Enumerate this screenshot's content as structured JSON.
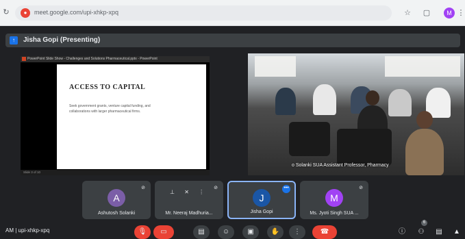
{
  "browser": {
    "url": "meet.google.com/upi-xhkp-xpq",
    "site_icon": "google-meet-icon",
    "profile_letter": "M"
  },
  "presenting_bar": {
    "label": "Jisha Gopi (Presenting)"
  },
  "shared_screen": {
    "app_title": "PowerPoint Slide Show - Challenges and Solutions Pharmaceutical.pptx - PowerPoint",
    "slide_title": "ACCESS TO CAPITAL",
    "slide_body": "Seek government grants, venture capital funding, and collaborations with larger pharmaceutical firms.",
    "status_text": "Slide 3 of 10"
  },
  "camera": {
    "caption": "o Solanki SUA Assistant Professor, Pharmacy"
  },
  "participants": [
    {
      "initial": "A",
      "name": "Ashutosh Solanki",
      "color": "#7b5ea7"
    },
    {
      "initial": "",
      "name": "Mr. Neeraj Madhuria...",
      "color": ""
    },
    {
      "initial": "J",
      "name": "Jisha Gopi",
      "color": "#1a56a6"
    },
    {
      "initial": "M",
      "name": "Ms. Jyoti Singh SUA ...",
      "color": "#a142f4"
    }
  ],
  "bottom_bar": {
    "meeting_code": "AM  |  upi-xhkp-xpq",
    "participant_count": "6"
  },
  "colors": {
    "accent": "#1a73e8",
    "danger": "#ea4335",
    "background": "#202124",
    "tile": "#3c4043"
  }
}
